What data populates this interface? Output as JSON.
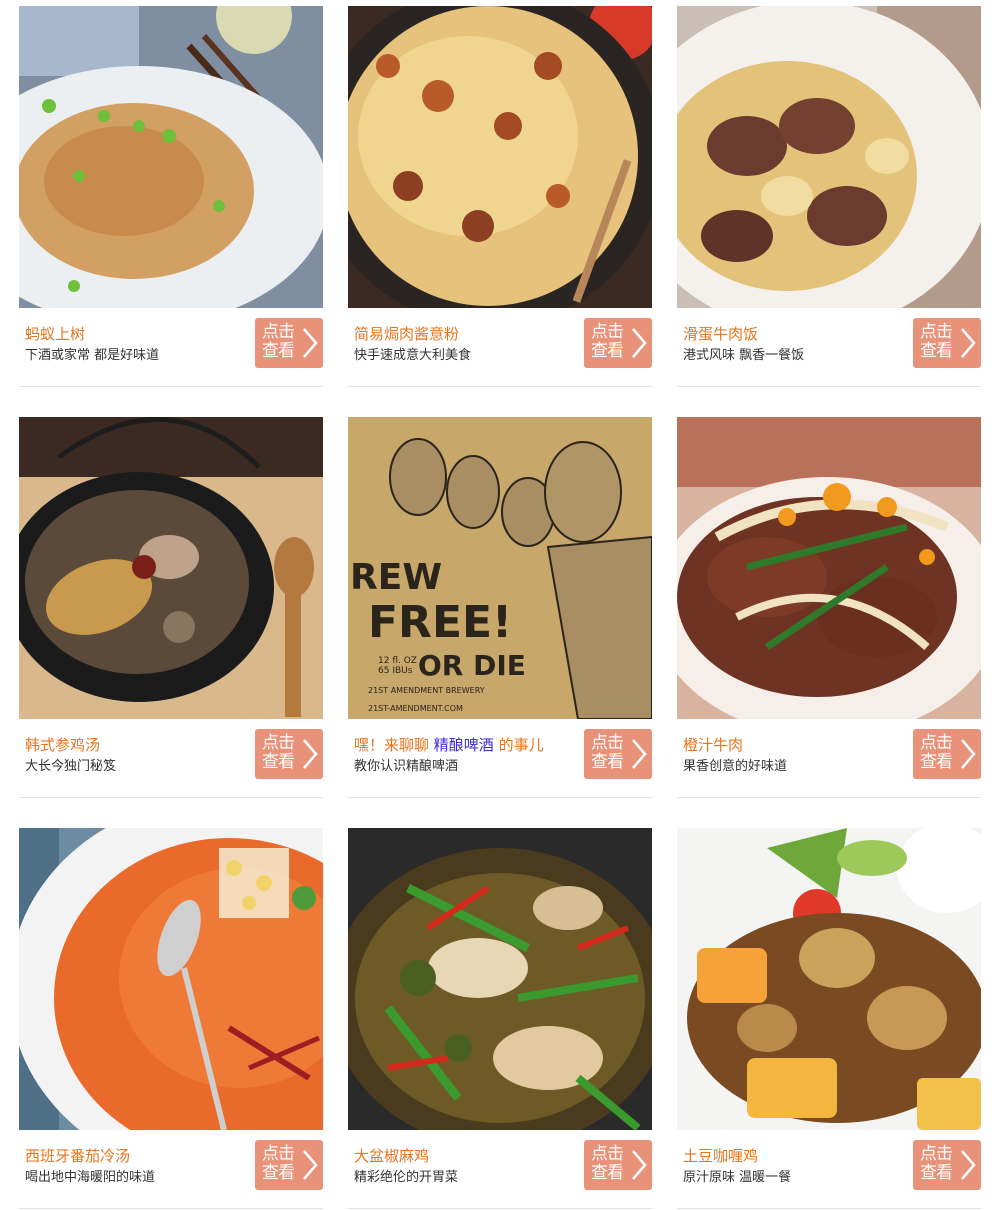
{
  "button": {
    "line1": "点击",
    "line2": "查看"
  },
  "colors": {
    "title": "#e8751e",
    "highlight": "#3b2bd6",
    "button": "#e9927a",
    "desc": "#333333"
  },
  "cards": [
    {
      "title": "蚂蚁上树",
      "desc": "下酒或家常 都是好味道"
    },
    {
      "title": "简易焗肉酱意粉",
      "desc": "快手速成意大利美食"
    },
    {
      "title": "滑蛋牛肉饭",
      "desc": "港式风味 飘香一餐饭"
    },
    {
      "title": "韩式参鸡汤",
      "desc": "大长今独门秘笈"
    },
    {
      "title_prefix": "嘿！来聊聊 ",
      "title_highlight": "精酿啤酒",
      "title_suffix": " 的事儿",
      "desc": "教你认识精酿啤酒",
      "poster": {
        "headline1": "REW",
        "headline2": "FREE!",
        "headline3": "OR DIE",
        "specs": "12 fl. OZ",
        "ibus": "65 IBUs",
        "brewery": "21ST AMENDMENT BREWERY",
        "url": "21ST-AMENDMENT.COM"
      }
    },
    {
      "title": "橙汁牛肉",
      "desc": "果香创意的好味道"
    },
    {
      "title": "西班牙番茄冷汤",
      "desc": "喝出地中海暖阳的味道"
    },
    {
      "title": "大盆椒麻鸡",
      "desc": "精彩绝伦的开胃菜"
    },
    {
      "title": "土豆咖喱鸡",
      "desc": "原汁原味 温暖一餐"
    }
  ]
}
